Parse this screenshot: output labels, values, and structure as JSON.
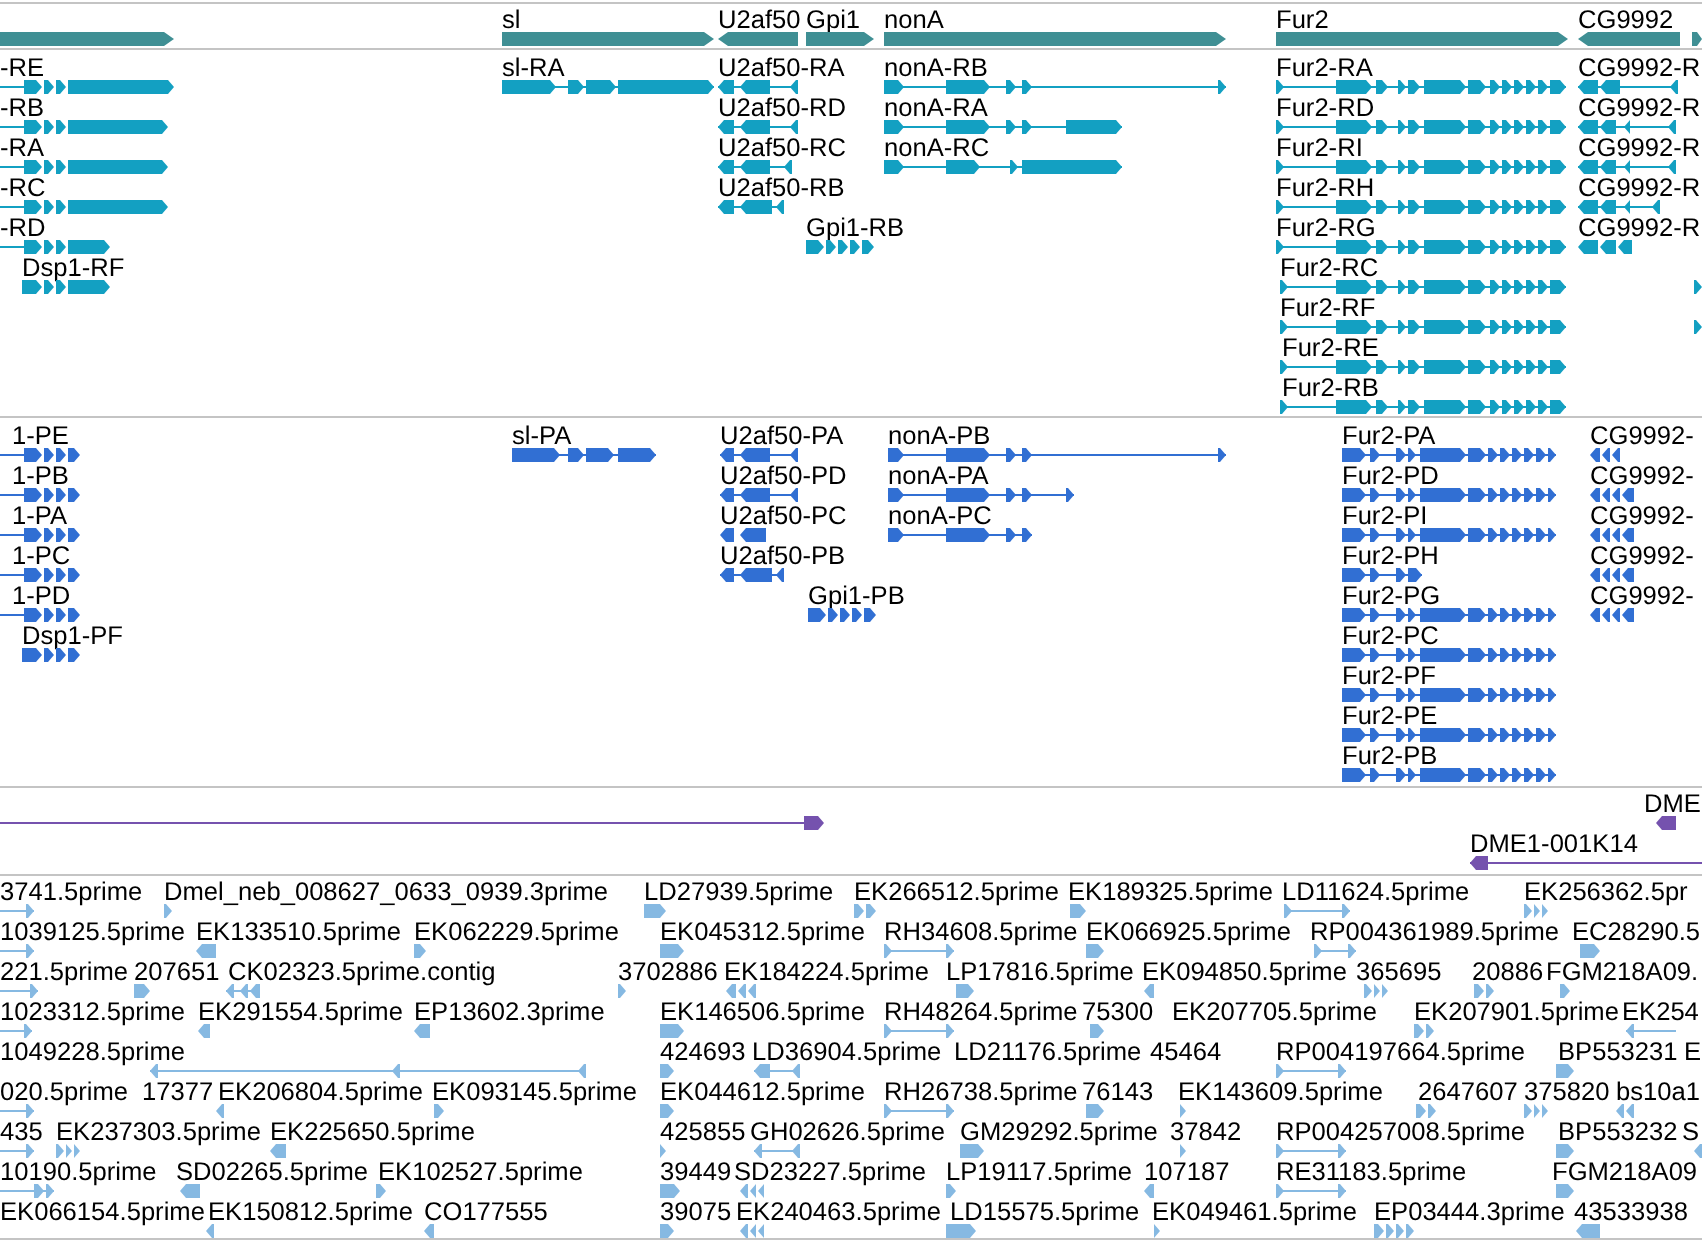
{
  "tracks": [
    {
      "kind": "gene",
      "features": [
        {
          "reverse": false
        },
        {
          "label": "sl",
          "reverse": false
        },
        {
          "label": "U2af50",
          "reverse": true
        },
        {
          "label": "Gpi1",
          "reverse": false
        },
        {
          "label": "nonA",
          "reverse": false
        },
        {
          "label": "Fur2",
          "reverse": false
        },
        {
          "label": "CG9992",
          "reverse": true
        },
        {
          "reverse": false
        }
      ]
    },
    {
      "kind": "transcript",
      "features": [
        {
          "label": "-RE",
          "reverse": false
        },
        {
          "label": "sl-RA",
          "reverse": false
        },
        {
          "label": "U2af50-RA",
          "reverse": true
        },
        {
          "label": "nonA-RB",
          "reverse": false
        },
        {
          "label": "Fur2-RA",
          "reverse": false
        },
        {
          "label": "CG9992-R",
          "reverse": true
        },
        {
          "label": "-RB",
          "reverse": false
        },
        {
          "label": "U2af50-RD",
          "reverse": true
        },
        {
          "label": "nonA-RA",
          "reverse": false
        },
        {
          "label": "Fur2-RD",
          "reverse": false
        },
        {
          "label": "CG9992-R",
          "reverse": true
        },
        {
          "label": "-RA",
          "reverse": false
        },
        {
          "label": "U2af50-RC",
          "reverse": true
        },
        {
          "label": "nonA-RC",
          "reverse": false
        },
        {
          "label": "Fur2-RI",
          "reverse": false
        },
        {
          "label": "CG9992-R",
          "reverse": true
        },
        {
          "label": "-RC",
          "reverse": false
        },
        {
          "label": "U2af50-RB",
          "reverse": true
        },
        {
          "label": "Fur2-RH",
          "reverse": false
        },
        {
          "label": "CG9992-R",
          "reverse": true
        },
        {
          "label": "-RD",
          "reverse": false
        },
        {
          "label": "Gpi1-RB",
          "reverse": false
        },
        {
          "label": "Fur2-RG",
          "reverse": false
        },
        {
          "label": "CG9992-R",
          "reverse": true
        },
        {
          "label": "Dsp1-RF",
          "reverse": false
        },
        {
          "label": "Fur2-RC",
          "reverse": false
        },
        {
          "reverse": false
        },
        {
          "label": "Fur2-RF",
          "reverse": false
        },
        {
          "reverse": false
        },
        {
          "label": "Fur2-RE",
          "reverse": false
        },
        {
          "label": "Fur2-RB",
          "reverse": false
        }
      ]
    },
    {
      "kind": "protein",
      "features": [
        {
          "label": "1-PE",
          "reverse": false
        },
        {
          "label": "sl-PA",
          "reverse": false
        },
        {
          "label": "U2af50-PA",
          "reverse": true
        },
        {
          "label": "nonA-PB",
          "reverse": false
        },
        {
          "label": "Fur2-PA",
          "reverse": false
        },
        {
          "label": "CG9992-",
          "reverse": true
        },
        {
          "label": "1-PB",
          "reverse": false
        },
        {
          "label": "U2af50-PD",
          "reverse": true
        },
        {
          "label": "nonA-PA",
          "reverse": false
        },
        {
          "label": "Fur2-PD",
          "reverse": false
        },
        {
          "label": "CG9992-",
          "reverse": true
        },
        {
          "label": "1-PA",
          "reverse": false
        },
        {
          "label": "U2af50-PC",
          "reverse": true
        },
        {
          "label": "nonA-PC",
          "reverse": false
        },
        {
          "label": "Fur2-PI",
          "reverse": false
        },
        {
          "label": "CG9992-",
          "reverse": true
        },
        {
          "label": "1-PC",
          "reverse": false
        },
        {
          "label": "U2af50-PB",
          "reverse": true
        },
        {
          "label": "Fur2-PH",
          "reverse": false
        },
        {
          "label": "CG9992-",
          "reverse": true
        },
        {
          "label": "1-PD",
          "reverse": false
        },
        {
          "label": "Gpi1-PB",
          "reverse": false
        },
        {
          "label": "Fur2-PG",
          "reverse": false
        },
        {
          "label": "CG9992-",
          "reverse": true
        },
        {
          "label": "Dsp1-PF",
          "reverse": false
        },
        {
          "label": "Fur2-PC",
          "reverse": false
        },
        {
          "label": "Fur2-PF",
          "reverse": false
        },
        {
          "label": "Fur2-PE",
          "reverse": false
        },
        {
          "label": "Fur2-PB",
          "reverse": false
        }
      ]
    },
    {
      "kind": "clone",
      "features": [
        {
          "reverse": false
        },
        {
          "label": "DME",
          "reverse": true
        },
        {
          "label": "DME1-001K14",
          "reverse": true
        }
      ]
    },
    {
      "kind": "est",
      "features": [
        {
          "label": "3741.5prime",
          "reverse": false
        },
        {
          "label": "Dmel_neb_008627_0633_0939.3prime",
          "reverse": false
        },
        {
          "label": "LD27939.5prime",
          "reverse": false
        },
        {
          "label": "EK266512.5prime",
          "reverse": false
        },
        {
          "label": "EK189325.5prime",
          "reverse": false
        },
        {
          "label": "LD11624.5prime",
          "reverse": false
        },
        {
          "label": "EK256362.5pr",
          "reverse": false
        },
        {
          "label": "1039125.5prime",
          "reverse": false
        },
        {
          "label": "EK133510.5prime",
          "reverse": true
        },
        {
          "label": "EK062229.5prime",
          "reverse": false
        },
        {
          "label": "EK045312.5prime",
          "reverse": false
        },
        {
          "label": "RH34608.5prime",
          "reverse": false
        },
        {
          "label": "EK066925.5prime",
          "reverse": false
        },
        {
          "label": "RP004361989.5prime",
          "reverse": false
        },
        {
          "label": "EC28290.5",
          "reverse": false
        },
        {
          "label": "221.5prime",
          "reverse": false
        },
        {
          "label": "207651",
          "reverse": false
        },
        {
          "label": "CK02323.5prime.contig",
          "reverse": true
        },
        {
          "label": "3702886",
          "reverse": false
        },
        {
          "label": "EK184224.5prime",
          "reverse": true
        },
        {
          "label": "LP17816.5prime",
          "reverse": false
        },
        {
          "label": "EK094850.5prime",
          "reverse": true
        },
        {
          "label": "365695",
          "reverse": false
        },
        {
          "label": "20886",
          "reverse": false
        },
        {
          "label": "FGM218A09.",
          "reverse": false
        },
        {
          "label": "1023312.5prime",
          "reverse": false
        },
        {
          "label": "EK291554.5prime",
          "reverse": true
        },
        {
          "label": "EP13602.3prime",
          "reverse": true
        },
        {
          "label": "EK146506.5prime",
          "reverse": false
        },
        {
          "label": "RH48264.5prime",
          "reverse": false
        },
        {
          "label": "75300",
          "reverse": false
        },
        {
          "label": "EK207705.5prime"
        },
        {
          "label": "EK207901.5prime",
          "reverse": false
        },
        {
          "label": "EK254",
          "reverse": true
        },
        {
          "label": "1049228.5prime",
          "reverse": true
        },
        {
          "label": "424693",
          "reverse": false
        },
        {
          "label": "LD36904.5prime",
          "reverse": true
        },
        {
          "label": "LD21176.5prime"
        },
        {
          "label": "45464"
        },
        {
          "label": "RP004197664.5prime",
          "reverse": false
        },
        {
          "label": "BP553231",
          "reverse": false
        },
        {
          "label": "E"
        },
        {
          "label": "020.5prime",
          "reverse": false
        },
        {
          "label": "17377"
        },
        {
          "label": "EK206804.5prime",
          "reverse": true
        },
        {
          "label": "EK093145.5prime",
          "reverse": false
        },
        {
          "label": "EK044612.5prime",
          "reverse": false
        },
        {
          "label": "RH26738.5prime",
          "reverse": false
        },
        {
          "label": "76143",
          "reverse": false
        },
        {
          "label": "EK143609.5prime",
          "reverse": false
        },
        {
          "label": "2647607",
          "reverse": false
        },
        {
          "label": "375820",
          "reverse": false
        },
        {
          "label": "bs10a1",
          "reverse": true
        },
        {
          "label": "435",
          "reverse": false
        },
        {
          "label": "EK237303.5prime",
          "reverse": false
        },
        {
          "label": "EK225650.5prime",
          "reverse": true
        },
        {
          "label": "425855",
          "reverse": false
        },
        {
          "label": "GH02626.5prime",
          "reverse": true
        },
        {
          "label": "GM29292.5prime",
          "reverse": false
        },
        {
          "label": "37842",
          "reverse": false
        },
        {
          "label": "RP004257008.5prime",
          "reverse": false
        },
        {
          "label": "BP553232",
          "reverse": false
        },
        {
          "label": "S",
          "reverse": true
        },
        {
          "label": "10190.5prime",
          "reverse": false
        },
        {
          "label": "SD02265.5prime",
          "reverse": true
        },
        {
          "label": "EK102527.5prime",
          "reverse": false
        },
        {
          "label": "39449",
          "reverse": false
        },
        {
          "label": "SD23227.5prime",
          "reverse": true
        },
        {
          "label": "LP19117.5prime",
          "reverse": false
        },
        {
          "label": "107187",
          "reverse": true
        },
        {
          "label": "RE31183.5prime",
          "reverse": false
        },
        {
          "label": "FGM218A09",
          "reverse": false
        },
        {
          "label": "EK066154.5prime"
        },
        {
          "label": "EK150812.5prime",
          "reverse": true
        },
        {
          "label": "CO177555",
          "reverse": true
        },
        {
          "label": "39075",
          "reverse": false
        },
        {
          "label": "EK240463.5prime",
          "reverse": true
        },
        {
          "label": "LD15575.5prime",
          "reverse": false
        },
        {
          "label": "EK049461.5prime",
          "reverse": false
        },
        {
          "label": "EP03444.3prime",
          "reverse": false
        },
        {
          "label": "43533938",
          "reverse": true
        }
      ]
    }
  ]
}
